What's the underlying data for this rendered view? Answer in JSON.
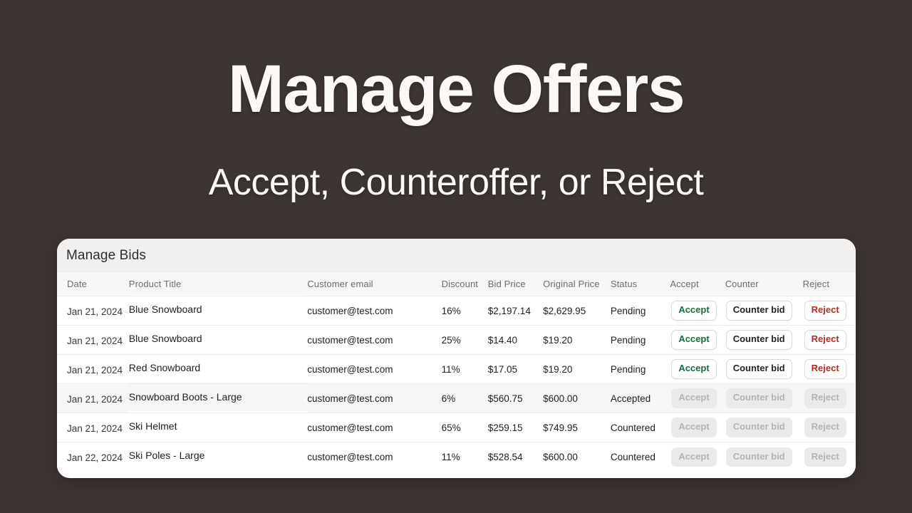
{
  "hero": {
    "title": "Manage Offers",
    "subtitle": "Accept, Counteroffer, or Reject"
  },
  "card": {
    "header_title": "Manage Bids",
    "columns": {
      "date": "Date",
      "product_title": "Product Title",
      "customer_email": "Customer email",
      "discount": "Discount",
      "bid_price": "Bid Price",
      "original_price": "Original Price",
      "status": "Status",
      "accept": "Accept",
      "counter": "Counter",
      "reject": "Reject"
    },
    "buttons": {
      "accept_label": "Accept",
      "counter_label": "Counter bid",
      "reject_label": "Reject"
    },
    "rows": [
      {
        "date": "Jan 21, 2024",
        "product_title": "Blue Snowboard",
        "customer_email": "customer@test.com",
        "discount": "16%",
        "bid_price": "$2,197.14",
        "original_price": "$2,629.95",
        "status": "Pending",
        "actions_enabled": true,
        "highlight": false
      },
      {
        "date": "Jan 21, 2024",
        "product_title": "Blue Snowboard",
        "customer_email": "customer@test.com",
        "discount": "25%",
        "bid_price": "$14.40",
        "original_price": "$19.20",
        "status": "Pending",
        "actions_enabled": true,
        "highlight": false
      },
      {
        "date": "Jan 21, 2024",
        "product_title": "Red Snowboard",
        "customer_email": "customer@test.com",
        "discount": "11%",
        "bid_price": "$17.05",
        "original_price": "$19.20",
        "status": "Pending",
        "actions_enabled": true,
        "highlight": false
      },
      {
        "date": "Jan 21, 2024",
        "product_title": "Snowboard Boots - Large",
        "customer_email": "customer@test.com",
        "discount": "6%",
        "bid_price": "$560.75",
        "original_price": "$600.00",
        "status": "Accepted",
        "actions_enabled": false,
        "highlight": true
      },
      {
        "date": "Jan 21, 2024",
        "product_title": "Ski Helmet",
        "customer_email": "customer@test.com",
        "discount": "65%",
        "bid_price": "$259.15",
        "original_price": "$749.95",
        "status": "Countered",
        "actions_enabled": false,
        "highlight": false
      },
      {
        "date": "Jan 22, 2024",
        "product_title": "Ski Poles - Large",
        "customer_email": "customer@test.com",
        "discount": "11%",
        "bid_price": "$528.54",
        "original_price": "$600.00",
        "status": "Countered",
        "actions_enabled": false,
        "highlight": false
      }
    ]
  },
  "colors": {
    "background": "#3d3531",
    "card_background": "#ffffff",
    "card_header_background": "#f1f0ef",
    "accept_text": "#1a6b40",
    "reject_text": "#b32d1f",
    "counter_text": "#232323",
    "disabled_text": "#b3b3b3",
    "disabled_background": "#eaeaea",
    "row_highlight": "#f6f6f5"
  }
}
